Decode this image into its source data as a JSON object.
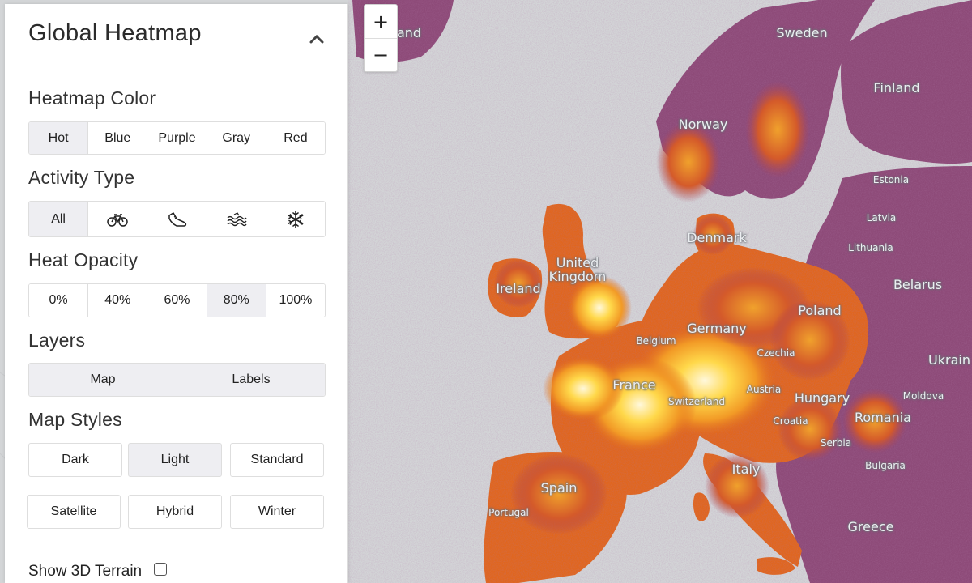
{
  "panel": {
    "title": "Global Heatmap",
    "heatmap_color": {
      "label": "Heatmap Color",
      "options": [
        "Hot",
        "Blue",
        "Purple",
        "Gray",
        "Red"
      ],
      "selected": "Hot"
    },
    "activity_type": {
      "label": "Activity Type",
      "all_label": "All",
      "icons": [
        "bike-icon",
        "shoe-icon",
        "water-icon",
        "snowflake-icon"
      ],
      "selected": "All"
    },
    "heat_opacity": {
      "label": "Heat Opacity",
      "options": [
        "0%",
        "40%",
        "60%",
        "80%",
        "100%"
      ],
      "selected": "80%"
    },
    "layers": {
      "label": "Layers",
      "options": [
        "Map",
        "Labels"
      ],
      "selected": "Map"
    },
    "map_styles": {
      "label": "Map Styles",
      "options": [
        "Dark",
        "Light",
        "Standard",
        "Satellite",
        "Hybrid",
        "Winter"
      ],
      "selected": "Light"
    },
    "terrain": {
      "label": "Show 3D Terrain",
      "checked": false
    }
  },
  "zoom": {
    "in_label": "+",
    "out_label": "−"
  },
  "map": {
    "labels": [
      "Sweden",
      "Finland",
      "Norway",
      "Estonia",
      "Latvia",
      "Denmark",
      "Lithuania",
      "United Kingdom",
      "Ireland",
      "Belarus",
      "Poland",
      "Germany",
      "Belgium",
      "Czechia",
      "Ukrain",
      "France",
      "Austria",
      "Moldova",
      "Hungary",
      "Switzerland",
      "Croatia",
      "Romania",
      "Serbia",
      "Italy",
      "Bulgaria",
      "Spain",
      "Portugal",
      "Greece",
      "and"
    ]
  },
  "colors": {
    "panel_bg": "#ffffff",
    "active_bg": "#eeeef2",
    "heat_low": "#7a3d6e",
    "heat_mid": "#e0661e",
    "heat_high": "#ffd54a",
    "heat_peak": "#fff6d0",
    "sea": "#d3d5d7"
  }
}
